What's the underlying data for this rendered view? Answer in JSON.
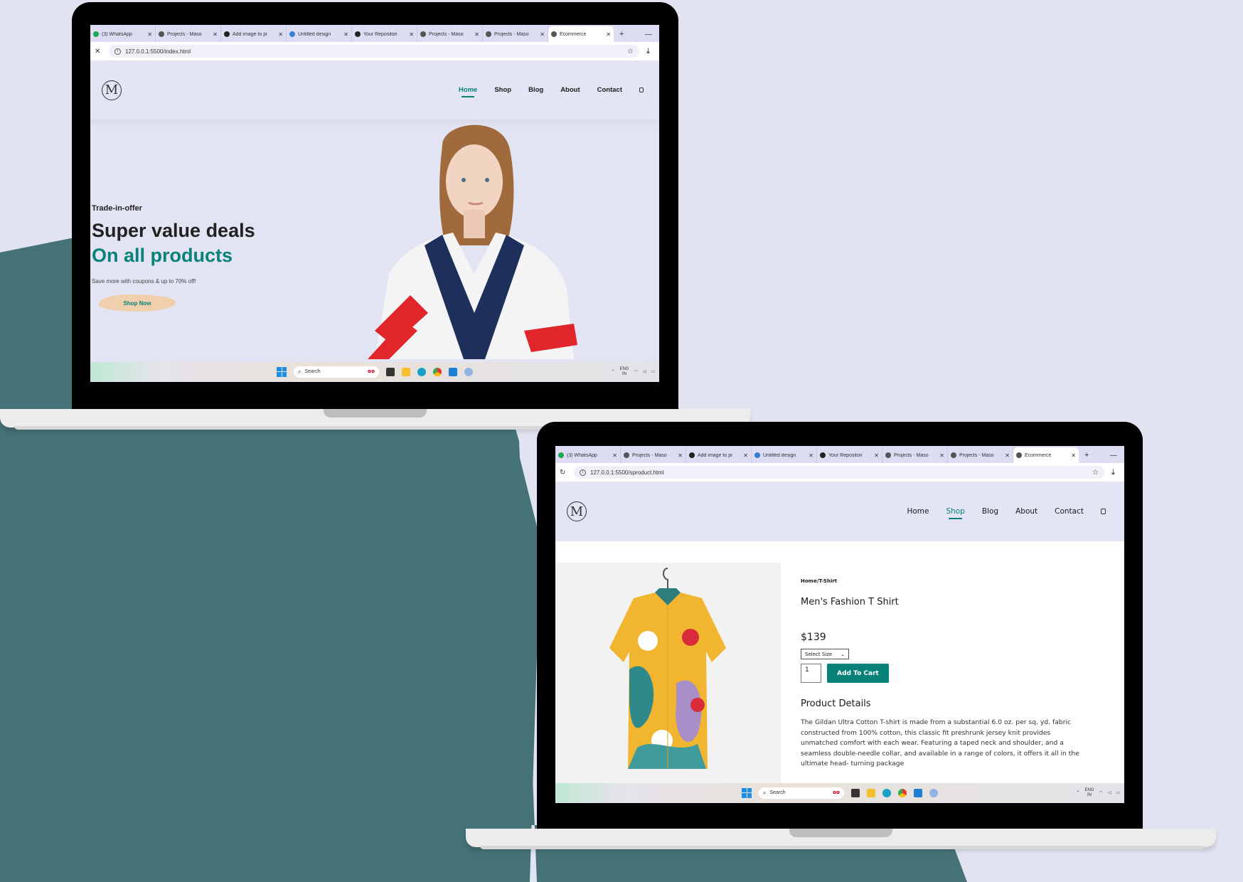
{
  "colors": {
    "accent": "#088178",
    "background": "#e1e3f1",
    "teal_shape": "#447277",
    "shop_now_bg": "#f0cfad"
  },
  "tabs": [
    {
      "label": "(3) WhatsApp",
      "icon": "whatsapp-icon"
    },
    {
      "label": "Projects - Maso",
      "icon": "globe-icon"
    },
    {
      "label": "Add image to pi",
      "icon": "github-icon"
    },
    {
      "label": "Untitled design",
      "icon": "canva-icon"
    },
    {
      "label": "Your Repositori",
      "icon": "github-icon"
    },
    {
      "label": "Projects - Maso",
      "icon": "globe-icon"
    },
    {
      "label": "Projects - Maso",
      "icon": "globe-icon"
    },
    {
      "label": "Ecommerce",
      "icon": "globe-icon",
      "active": true
    }
  ],
  "laptop1": {
    "url": "127.0.0.1:5500/index.html",
    "nav": [
      "Home",
      "Shop",
      "Blog",
      "About",
      "Contact"
    ],
    "active_nav": "Home",
    "hero": {
      "tag": "Trade-in-offer",
      "title": "Super value deals",
      "highlight": "On all products",
      "subtitle": "Save more with coupons & up to 70% off!",
      "button": "Shop Now"
    }
  },
  "laptop2": {
    "url": "127.0.0.1:5500/sproduct.html",
    "nav": [
      "Home",
      "Shop",
      "Blog",
      "About",
      "Contact"
    ],
    "active_nav": "Shop",
    "product": {
      "breadcrumb": "Home/T-Shirt",
      "title": "Men's Fashion T Shirt",
      "price": "$139",
      "size_placeholder": "Select Size",
      "quantity": "1",
      "add_button": "Add To Cart",
      "details_heading": "Product Details",
      "details_text": "The Gildan Ultra Cotton T-shirt is made from a substantial 6.0 oz. per sq. yd. fabric constructed from 100% cotton, this classic fit preshrunk jersey knit provides unmatched comfort with each wear. Featuring a taped neck and shoulder, and a seamless double-needle collar, and available in a range of colors, it offers it all in the ultimate head- turning package"
    }
  },
  "taskbar": {
    "search": "Search",
    "lang_top": "ENG",
    "lang_bottom": "IN"
  }
}
